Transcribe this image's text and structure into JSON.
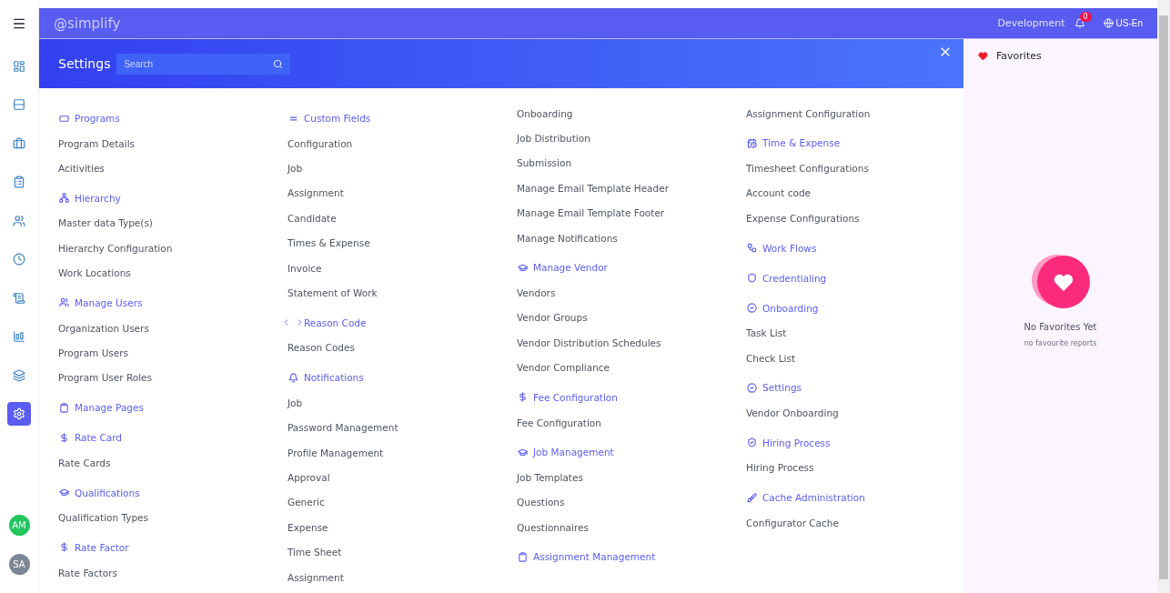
{
  "topbar": {
    "brand": "@simplify",
    "environment": "Development",
    "notification_count": "0",
    "language": "US-En"
  },
  "sidebar": {
    "items": [
      {
        "selected": false
      },
      {
        "selected": false
      },
      {
        "selected": false
      },
      {
        "selected": false
      },
      {
        "selected": false
      },
      {
        "selected": false
      },
      {
        "selected": false
      },
      {
        "selected": false
      },
      {
        "selected": false
      },
      {
        "selected": true
      }
    ],
    "avatars": [
      {
        "initials": "AM",
        "color": "#22c55e"
      },
      {
        "initials": "SA",
        "color": "#7d8694"
      }
    ]
  },
  "settings": {
    "title": "Settings",
    "search": {
      "placeholder": "Search"
    },
    "columns": [
      [
        {
          "kind": "heading",
          "label": "Programs"
        },
        {
          "kind": "link",
          "label": "Program Details"
        },
        {
          "kind": "link",
          "label": "Acitivities"
        },
        {
          "kind": "heading",
          "label": "Hierarchy"
        },
        {
          "kind": "link",
          "label": "Master data Type(s)"
        },
        {
          "kind": "link",
          "label": "Hierarchy Configuration"
        },
        {
          "kind": "link",
          "label": "Work Locations"
        },
        {
          "kind": "heading",
          "label": "Manage Users"
        },
        {
          "kind": "link",
          "label": "Organization Users"
        },
        {
          "kind": "link",
          "label": "Program Users"
        },
        {
          "kind": "link",
          "label": "Program User Roles"
        },
        {
          "kind": "heading",
          "label": "Manage Pages"
        },
        {
          "kind": "heading",
          "label": "Rate Card"
        },
        {
          "kind": "link",
          "label": "Rate Cards"
        },
        {
          "kind": "heading",
          "label": "Qualifications"
        },
        {
          "kind": "link",
          "label": "Qualification Types"
        },
        {
          "kind": "heading",
          "label": "Rate Factor"
        },
        {
          "kind": "link",
          "label": "Rate Factors"
        }
      ],
      [
        {
          "kind": "heading",
          "label": "Custom Fields"
        },
        {
          "kind": "link",
          "label": "Configuration"
        },
        {
          "kind": "link",
          "label": "Job"
        },
        {
          "kind": "link",
          "label": "Assignment"
        },
        {
          "kind": "link",
          "label": "Candidate"
        },
        {
          "kind": "link",
          "label": "Times & Expense"
        },
        {
          "kind": "link",
          "label": "Invoice"
        },
        {
          "kind": "link",
          "label": "Statement of Work"
        },
        {
          "kind": "heading",
          "label": "Reason Code"
        },
        {
          "kind": "link",
          "label": "Reason Codes"
        },
        {
          "kind": "heading",
          "label": "Notifications"
        },
        {
          "kind": "link",
          "label": "Job"
        },
        {
          "kind": "link",
          "label": "Password Management"
        },
        {
          "kind": "link",
          "label": "Profile Management"
        },
        {
          "kind": "link",
          "label": "Approval"
        },
        {
          "kind": "link",
          "label": "Generic"
        },
        {
          "kind": "link",
          "label": "Expense"
        },
        {
          "kind": "link",
          "label": "Time Sheet"
        },
        {
          "kind": "link",
          "label": "Assignment"
        }
      ],
      [
        {
          "kind": "link",
          "label": "Onboarding"
        },
        {
          "kind": "link",
          "label": "Job Distribution"
        },
        {
          "kind": "link",
          "label": "Submission"
        },
        {
          "kind": "link",
          "label": "Manage Email Template Header"
        },
        {
          "kind": "link",
          "label": "Manage Email Template Footer"
        },
        {
          "kind": "link",
          "label": "Manage Notifications"
        },
        {
          "kind": "heading",
          "label": "Manage Vendor"
        },
        {
          "kind": "link",
          "label": "Vendors"
        },
        {
          "kind": "link",
          "label": "Vendor Groups"
        },
        {
          "kind": "link",
          "label": "Vendor Distribution Schedules"
        },
        {
          "kind": "link",
          "label": "Vendor Compliance"
        },
        {
          "kind": "heading",
          "label": "Fee Configuration"
        },
        {
          "kind": "link",
          "label": "Fee Configuration"
        },
        {
          "kind": "heading",
          "label": "Job Management"
        },
        {
          "kind": "link",
          "label": "Job Templates"
        },
        {
          "kind": "link",
          "label": "Questions"
        },
        {
          "kind": "link",
          "label": "Questionnaires"
        },
        {
          "kind": "heading",
          "label": "Assignment Management"
        }
      ],
      [
        {
          "kind": "link",
          "label": "Assignment Configuration"
        },
        {
          "kind": "heading",
          "label": "Time & Expense"
        },
        {
          "kind": "link",
          "label": "Timesheet Configurations"
        },
        {
          "kind": "link",
          "label": "Account code"
        },
        {
          "kind": "link",
          "label": "Expense Configurations"
        },
        {
          "kind": "heading",
          "label": "Work Flows"
        },
        {
          "kind": "heading",
          "label": "Credentialing"
        },
        {
          "kind": "heading",
          "label": "Onboarding"
        },
        {
          "kind": "link",
          "label": "Task List"
        },
        {
          "kind": "link",
          "label": "Check List"
        },
        {
          "kind": "heading",
          "label": "Settings"
        },
        {
          "kind": "link",
          "label": "Vendor Onboarding"
        },
        {
          "kind": "heading",
          "label": "Hiring Process"
        },
        {
          "kind": "link",
          "label": "Hiring Process"
        },
        {
          "kind": "heading",
          "label": "Cache Administration"
        },
        {
          "kind": "link",
          "label": "Configurator Cache"
        }
      ]
    ]
  },
  "favorites": {
    "title": "Favorites",
    "empty_title": "No Favorites Yet",
    "empty_subtitle": "no favourite reports"
  }
}
